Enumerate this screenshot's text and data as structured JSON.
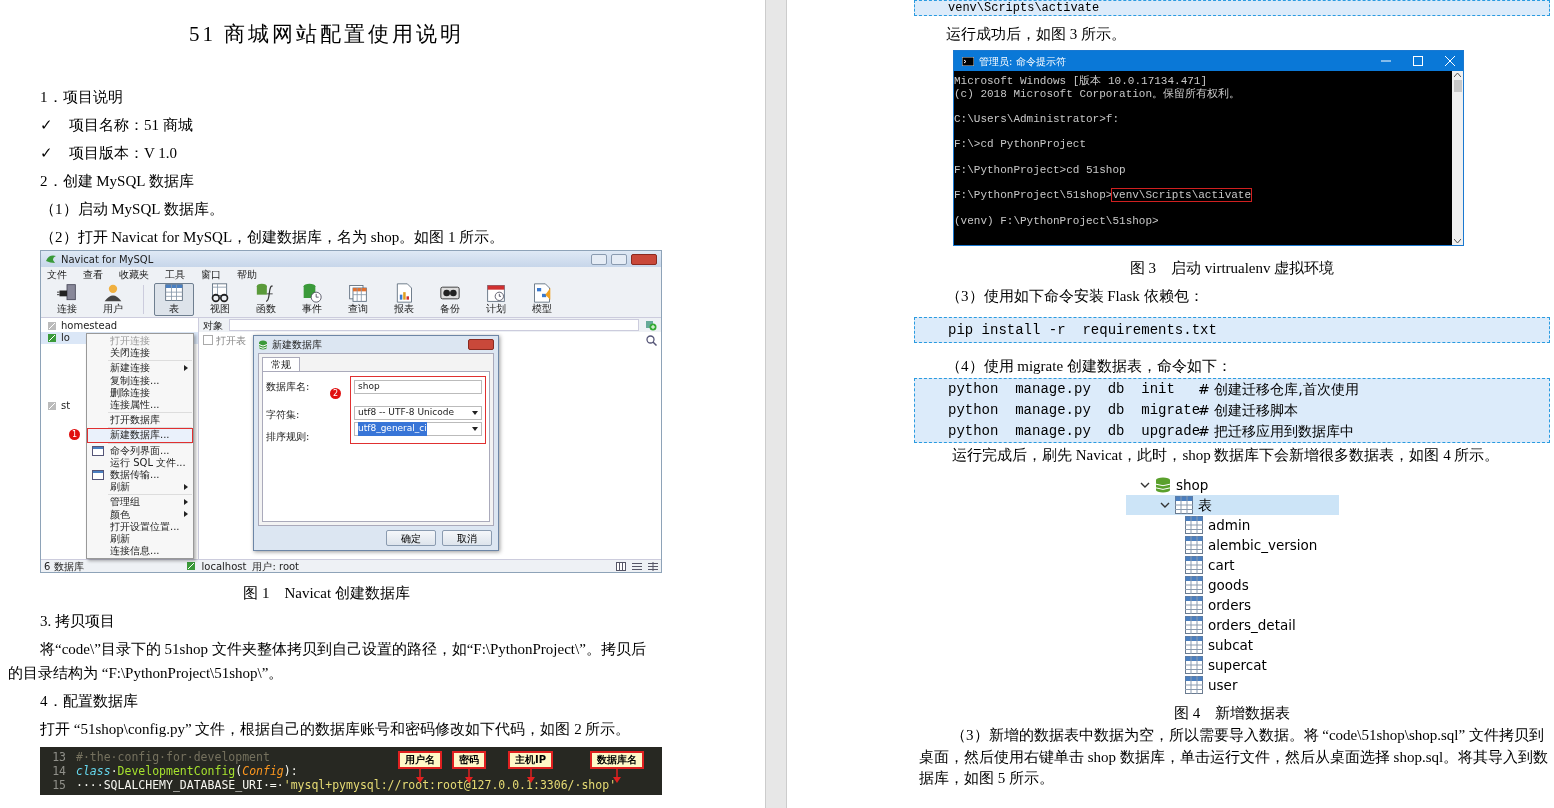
{
  "left_page": {
    "title": "51 商城网站配置使用说明",
    "blocks": [
      {
        "kind": "heading",
        "text": "1．项目说明"
      },
      {
        "kind": "check",
        "marker": "✓",
        "text": "项目名称：51 商城"
      },
      {
        "kind": "check",
        "marker": "✓",
        "text": "项目版本：V 1.0"
      },
      {
        "kind": "heading",
        "text": "2．创建 MySQL 数据库"
      },
      {
        "kind": "step",
        "text": "（1）启动 MySQL 数据库。"
      },
      {
        "kind": "step",
        "text": "（2）打开 Navicat for MySQL，创建数据库，名为 shop。如图 1 所示。"
      },
      {
        "kind": "navicat"
      },
      {
        "kind": "caption",
        "text": "图 1　Navicat 创建数据库"
      },
      {
        "kind": "heading",
        "text": "3. 拷贝项目"
      },
      {
        "kind": "para",
        "text": "将“code\\”目录下的 51shop 文件夹整体拷贝到自己设置的路径，如“F:\\PythonProject\\”。拷贝后的目录结构为 “F:\\PythonProject\\51shop\\”。"
      },
      {
        "kind": "heading",
        "text": "4．配置数据库"
      },
      {
        "kind": "para",
        "text": "打开 “51shop\\config.py” 文件，根据自己的数据库账号和密码修改如下代码，如图 2 所示。"
      },
      {
        "kind": "code_image"
      }
    ]
  },
  "navicat": {
    "title": "Navicat for MySQL",
    "menu": [
      "文件",
      "查看",
      "收藏夹",
      "工具",
      "窗口",
      "帮助"
    ],
    "toolbar": [
      {
        "label": "连接",
        "selected": false
      },
      {
        "label": "用户",
        "selected": false
      },
      {
        "label": "表",
        "selected": true
      },
      {
        "label": "视图",
        "selected": false
      },
      {
        "label": "函数",
        "selected": false
      },
      {
        "label": "事件",
        "selected": false
      },
      {
        "label": "查询",
        "selected": false
      },
      {
        "label": "报表",
        "selected": false
      },
      {
        "label": "备份",
        "selected": false
      },
      {
        "label": "计划",
        "selected": false
      },
      {
        "label": "模型",
        "selected": false
      }
    ],
    "tree": [
      {
        "label": "homestead",
        "selected": false
      },
      {
        "label": "lo",
        "selected": true
      },
      {
        "label": "st",
        "selected": false
      }
    ],
    "object_tab": "对象",
    "open_table": "打开表",
    "context_menu": [
      {
        "kind": "item",
        "label": "打开连接",
        "disabled": true,
        "submenu": false,
        "selected": false,
        "icon": false
      },
      {
        "kind": "item",
        "label": "关闭连接",
        "disabled": false,
        "submenu": false,
        "selected": false,
        "icon": false
      },
      {
        "kind": "separator"
      },
      {
        "kind": "item",
        "label": "新建连接",
        "disabled": false,
        "submenu": true,
        "selected": false,
        "icon": false
      },
      {
        "kind": "item",
        "label": "复制连接...",
        "disabled": false,
        "submenu": false,
        "selected": false,
        "icon": false
      },
      {
        "kind": "item",
        "label": "删除连接",
        "disabled": false,
        "submenu": false,
        "selected": false,
        "icon": false
      },
      {
        "kind": "item",
        "label": "连接属性...",
        "disabled": false,
        "submenu": false,
        "selected": false,
        "icon": false
      },
      {
        "kind": "separator"
      },
      {
        "kind": "item",
        "label": "打开数据库",
        "disabled": false,
        "submenu": false,
        "selected": false,
        "icon": false
      },
      {
        "kind": "separator"
      },
      {
        "kind": "item",
        "label": "新建数据库...",
        "disabled": false,
        "submenu": false,
        "selected": true,
        "icon": false,
        "badge": "1"
      },
      {
        "kind": "separator"
      },
      {
        "kind": "item",
        "label": "命令列界面...",
        "disabled": false,
        "submenu": false,
        "selected": false,
        "icon": true
      },
      {
        "kind": "item",
        "label": "运行 SQL 文件...",
        "disabled": false,
        "submenu": false,
        "selected": false,
        "icon": false
      },
      {
        "kind": "item",
        "label": "数据传输...",
        "disabled": false,
        "submenu": false,
        "selected": false,
        "icon": true
      },
      {
        "kind": "item",
        "label": "刷新",
        "disabled": false,
        "submenu": true,
        "selected": false,
        "icon": false
      },
      {
        "kind": "separator"
      },
      {
        "kind": "item",
        "label": "管理组",
        "disabled": false,
        "submenu": true,
        "selected": false,
        "icon": false
      },
      {
        "kind": "item",
        "label": "颜色",
        "disabled": false,
        "submenu": true,
        "selected": false,
        "icon": false
      },
      {
        "kind": "item",
        "label": "打开设置位置...",
        "disabled": false,
        "submenu": false,
        "selected": false,
        "icon": false
      },
      {
        "kind": "item",
        "label": "刷新",
        "disabled": false,
        "submenu": false,
        "selected": false,
        "icon": false
      },
      {
        "kind": "item",
        "label": "连接信息...",
        "disabled": false,
        "submenu": false,
        "selected": false,
        "icon": false
      }
    ],
    "dialog": {
      "title": "新建数据库",
      "tab": "常规",
      "badge": "2",
      "fields": [
        {
          "kind": "text",
          "label": "数据库名:",
          "value": "shop",
          "text_selected": false
        },
        {
          "kind": "dropdown",
          "label": "字符集:",
          "value": "utf8 -- UTF-8 Unicode",
          "text_selected": false
        },
        {
          "kind": "dropdown",
          "label": "排序规则:",
          "value": "utf8_general_ci",
          "text_selected": true
        }
      ],
      "buttons": [
        "确定",
        "取消"
      ]
    },
    "status": {
      "count": "6 数据库",
      "connection": "localhost",
      "user": "用户: root"
    }
  },
  "code_image": {
    "lines": [
      {
        "number": "13",
        "tokens": [
          {
            "kind": "comment",
            "text": "#·the·config·for·development"
          }
        ]
      },
      {
        "number": "14",
        "tokens": [
          {
            "kind": "keyword",
            "text": "class"
          },
          {
            "kind": "plain",
            "text": "·"
          },
          {
            "kind": "name",
            "text": "DevelopmentConfig"
          },
          {
            "kind": "plain",
            "text": "("
          },
          {
            "kind": "param",
            "text": "Config"
          },
          {
            "kind": "plain",
            "text": "):"
          }
        ]
      },
      {
        "number": "15",
        "tokens": [
          {
            "kind": "plain",
            "text": "····SQLALCHEMY_DATABASE_URI·=·"
          },
          {
            "kind": "string",
            "text": "'mysql+pymysql://root:root@127.0.0.1:3306/·shop'"
          }
        ]
      }
    ],
    "labels": [
      "用户名",
      "密码",
      "主机IP",
      "数据库名"
    ]
  },
  "right_page": {
    "blocks": [
      {
        "kind": "code",
        "lines": [
          {
            "command": "venv\\Scripts\\activate"
          }
        ]
      },
      {
        "kind": "para",
        "text": "运行成功后，如图 3 所示。"
      },
      {
        "kind": "cmd"
      },
      {
        "kind": "caption",
        "text": "图 3　启动 virtrualenv 虚拟环境"
      },
      {
        "kind": "step",
        "text": "（3）使用如下命令安装 Flask 依赖包："
      },
      {
        "kind": "code",
        "lines": [
          {
            "command": "pip install -r  requirements.txt"
          }
        ]
      },
      {
        "kind": "step",
        "text": "（4）使用 migrate 创建数据表，命令如下："
      },
      {
        "kind": "code",
        "lines": [
          {
            "command": "python  manage.py  db  init",
            "comment": "# 创建迁移仓库,首次使用"
          },
          {
            "command": "python  manage.py  db  migrate",
            "comment": "# 创建迁移脚本"
          },
          {
            "command": "python  manage.py  db  upgrade",
            "comment": "# 把迁移应用到数据库中"
          }
        ]
      },
      {
        "kind": "para",
        "text": "运行完成后，刷先 Navicat，此时，shop 数据库下会新增很多数据表，如图 4 所示。"
      },
      {
        "kind": "tree"
      },
      {
        "kind": "caption",
        "text": "图 4　新增数据表"
      },
      {
        "kind": "para",
        "text": "（3）新增的数据表中数据为空，所以需要导入数据。将 “code\\51shop\\shop.sql” 文件拷贝到桌面，然后使用右键单击 shop 数据库，单击运行文件，然后从桌面选择 shop.sql。将其导入到数据库，如图 5 所示。"
      }
    ]
  },
  "cmd": {
    "title": "管理员: 命令提示符",
    "lines": [
      {
        "kind": "line",
        "text": "Microsoft Windows [版本 10.0.17134.471]"
      },
      {
        "kind": "line",
        "text": "(c) 2018 Microsoft Corporation。保留所有权利。"
      },
      {
        "kind": "blank"
      },
      {
        "kind": "line",
        "text": "C:\\Users\\Administrator>f:"
      },
      {
        "kind": "blank"
      },
      {
        "kind": "line",
        "text": "F:\\>cd PythonProject"
      },
      {
        "kind": "blank"
      },
      {
        "kind": "line",
        "text": "F:\\PythonProject>cd 51shop"
      },
      {
        "kind": "blank"
      },
      {
        "kind": "line",
        "text": "F:\\PythonProject\\51shop>",
        "boxed": "venv\\Scripts\\activate"
      },
      {
        "kind": "blank"
      },
      {
        "kind": "line",
        "text": "(venv) F:\\PythonProject\\51shop>"
      }
    ]
  },
  "db_tree": [
    {
      "label": "shop",
      "expanded": true,
      "selected": false,
      "children": [
        {
          "label": "表",
          "expanded": true,
          "selected": true,
          "children": [
            {
              "label": "admin",
              "selected": false
            },
            {
              "label": "alembic_version",
              "selected": false
            },
            {
              "label": "cart",
              "selected": false
            },
            {
              "label": "goods",
              "selected": false
            },
            {
              "label": "orders",
              "selected": false
            },
            {
              "label": "orders_detail",
              "selected": false
            },
            {
              "label": "subcat",
              "selected": false
            },
            {
              "label": "supercat",
              "selected": false
            },
            {
              "label": "user",
              "selected": false
            }
          ]
        }
      ]
    }
  ]
}
